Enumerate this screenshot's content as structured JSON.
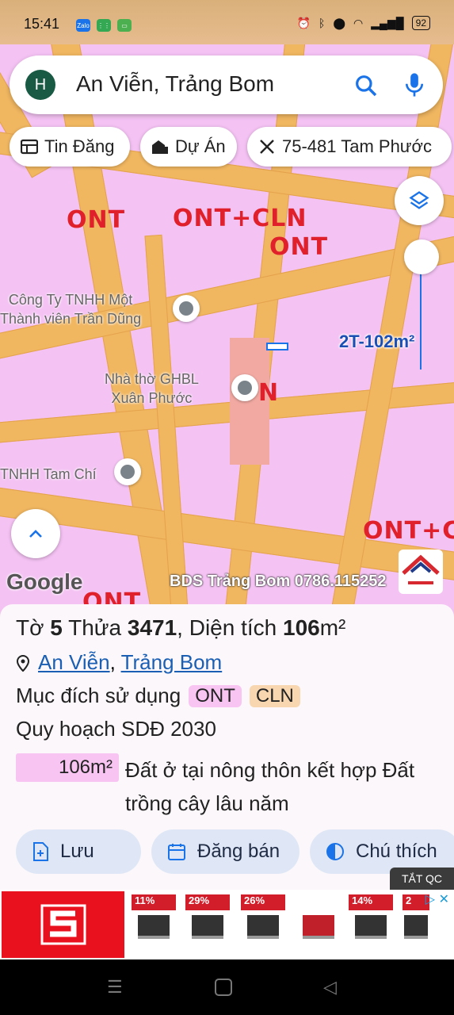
{
  "status_bar": {
    "time": "15:41",
    "battery": "92",
    "app1": "Zalo"
  },
  "search": {
    "avatar_letter": "H",
    "query": "An Viễn, Trảng Bom"
  },
  "chips": [
    {
      "label": "Tin Đăng"
    },
    {
      "label": "Dự Án"
    },
    {
      "label": "75-481 Tam Phước"
    }
  ],
  "map": {
    "zones": [
      "ONT",
      "ONT+CLN",
      "ONT",
      "ONT+CL",
      "ONT"
    ],
    "partial_zone": "N",
    "pois": [
      {
        "label": "Công Ty TNHH Một\nThành viên Trần Dũng"
      },
      {
        "label": "Nhà thờ GHBL\nXuân Phước"
      },
      {
        "label": "TNHH Tam Chí"
      }
    ],
    "area_label": "2T-102m²",
    "google_logo": "Google",
    "watermark": "BDS Trảng Bom 0786.115252"
  },
  "parcel": {
    "prefix1": "Tờ ",
    "sheet_no": "5",
    "prefix2": " Thửa ",
    "plot_no": "3471",
    "prefix3": ", Diện tích ",
    "area": "106",
    "unit": "m²",
    "commune": "An Viễn",
    "district": "Trảng Bom",
    "purpose_label": "Mục đích sử dụng",
    "tags": [
      "ONT",
      "CLN"
    ],
    "plan_label": "Quy hoạch SDĐ 2030",
    "legend_area": "106m²",
    "legend_desc": "Đất ở tại nông thôn kết hợp Đất trồng cây lâu năm"
  },
  "actions": [
    {
      "label": "Lưu"
    },
    {
      "label": "Đăng bán"
    },
    {
      "label": "Chú thích"
    }
  ],
  "ad": {
    "close_label": "TẮT QC",
    "badges": [
      "11%",
      "29%",
      "26%",
      "",
      "14%",
      "2"
    ]
  },
  "colors": {
    "accent": "#1a73e8",
    "zone_text": "#e0212c",
    "road": "#f0b660",
    "land": "#f4c2f3"
  }
}
